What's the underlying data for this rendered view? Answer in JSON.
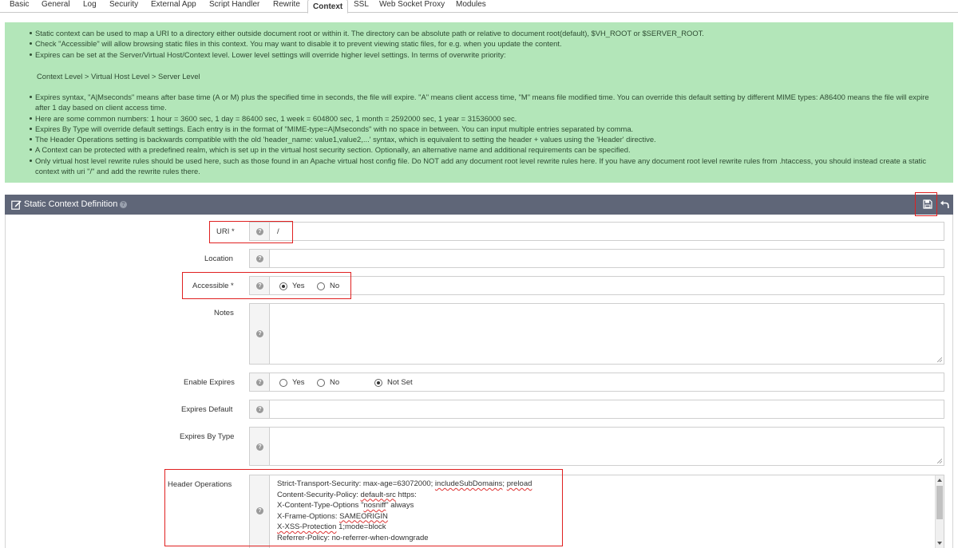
{
  "tabs": [
    {
      "label": "Basic",
      "active": false
    },
    {
      "label": "General",
      "active": false
    },
    {
      "label": "Log",
      "active": false
    },
    {
      "label": "Security",
      "active": false
    },
    {
      "label": "External App",
      "active": false
    },
    {
      "label": "Script Handler",
      "active": false
    },
    {
      "label": "Rewrite",
      "active": false
    },
    {
      "label": "Context",
      "active": true
    },
    {
      "label": "SSL",
      "active": false
    },
    {
      "label": "Web Socket Proxy",
      "active": false
    },
    {
      "label": "Modules",
      "active": false
    }
  ],
  "info": {
    "items_top": [
      "Static context can be used to map a URI to a directory either outside document root or within it. The directory can be absolute path or relative to document root(default), $VH_ROOT or $SERVER_ROOT.",
      "Check \"Accessible\" will allow browsing static files in this context. You may want to disable it to prevent viewing static files, for e.g. when you update the content.",
      "Expires can be set at the Server/Virtual Host/Context level. Lower level settings will override higher level settings. In terms of overwrite priority:"
    ],
    "priority_line": "Context Level > Virtual Host Level > Server Level",
    "items_bottom": [
      "Expires syntax, \"A|Mseconds\" means after base time (A or M) plus the specified time in seconds, the file will expire. \"A\" means client access time, \"M\" means file modified time. You can override this default setting by different MIME types: A86400 means the file will expire after 1 day based on client access time.",
      "Here are some common numbers: 1 hour = 3600 sec, 1 day = 86400 sec, 1 week = 604800 sec, 1 month = 2592000 sec, 1 year = 31536000 sec.",
      "Expires By Type will override default settings. Each entry is in the format of \"MIME-type=A|Mseconds\" with no space in between. You can input multiple entries separated by comma.",
      "The Header Operations setting is backwards compatible with the old 'header_name: value1,value2,...' syntax, which is equivalent to setting the header + values using the 'Header' directive.",
      "A Context can be protected with a predefined realm, which is set up in the virtual host security section. Optionally, an alternative name and additional requirements can be specified.",
      "Only virtual host level rewrite rules should be used here, such as those found in an Apache virtual host config file. Do NOT add any document root level rewrite rules here. If you have any document root level rewrite rules from .htaccess, you should instead create a static context with uri \"/\" and add the rewrite rules there."
    ]
  },
  "card": {
    "title": "Static Context Definition",
    "icons": {
      "edit": "edit-icon",
      "help": "help-icon",
      "save": "save-icon",
      "undo": "undo-icon"
    }
  },
  "form": {
    "uri": {
      "label": "URI *",
      "value": "/"
    },
    "location": {
      "label": "Location",
      "value": ""
    },
    "accessible": {
      "label": "Accessible *",
      "options": [
        "Yes",
        "No"
      ],
      "selected": "Yes"
    },
    "notes": {
      "label": "Notes",
      "value": ""
    },
    "enable_expires": {
      "label": "Enable Expires",
      "options": [
        "Yes",
        "No",
        "Not Set"
      ],
      "selected": "Not Set"
    },
    "expires_default": {
      "label": "Expires Default",
      "value": ""
    },
    "expires_by_type": {
      "label": "Expires By Type",
      "value": ""
    },
    "header_operations": {
      "label": "Header Operations",
      "lines": [
        "Strict-Transport-Security: max-age=63072000; includeSubDomains; preload",
        "Content-Security-Policy: default-src https:",
        "X-Content-Type-Options \"nosniff\" always",
        "X-Frame-Options: SAMEORIGIN",
        "X-XSS-Protection 1;mode=block",
        "Referrer-Policy: no-referrer-when-downgrade"
      ]
    }
  },
  "colors": {
    "info_bg": "#b3e6b9",
    "card_header_bg": "#5f6678",
    "highlight_red": "#e02020"
  }
}
